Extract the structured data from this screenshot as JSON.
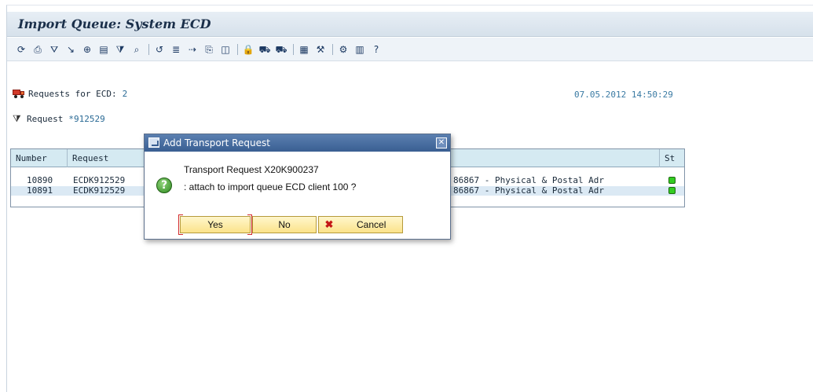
{
  "window": {
    "title": "Import Queue: System ECD"
  },
  "toolbar": {
    "icons": [
      {
        "name": "refresh-icon",
        "glyph": "⟳"
      },
      {
        "name": "print-icon",
        "glyph": "⎙"
      },
      {
        "name": "filter-icon",
        "glyph": "⛛"
      },
      {
        "name": "select-icon",
        "glyph": "↘"
      },
      {
        "name": "zoom-icon",
        "glyph": "⊕"
      },
      {
        "name": "display-icon",
        "glyph": "▤"
      },
      {
        "name": "set-filter-icon",
        "glyph": "⧩"
      },
      {
        "name": "find-icon",
        "glyph": "⌕"
      },
      {
        "name": "history-icon",
        "glyph": "↺"
      },
      {
        "name": "log-icon",
        "glyph": "≣"
      },
      {
        "name": "transport-icon",
        "glyph": "⇢"
      },
      {
        "name": "document-icon",
        "glyph": "⎘"
      },
      {
        "name": "details-icon",
        "glyph": "◫"
      },
      {
        "name": "lock-icon",
        "glyph": "🔒"
      },
      {
        "name": "import-truck-icon",
        "glyph": "⛟"
      },
      {
        "name": "import-all-icon",
        "glyph": "⛟"
      },
      {
        "name": "layout-icon",
        "glyph": "▦"
      },
      {
        "name": "tools-icon",
        "glyph": "⚒"
      },
      {
        "name": "settings-icon",
        "glyph": "⚙"
      },
      {
        "name": "grid-icon",
        "glyph": "▥"
      },
      {
        "name": "help-icon",
        "glyph": "?"
      }
    ]
  },
  "info": {
    "requests_label": "Requests for ECD:",
    "requests_count": "2",
    "timestamp": "07.05.2012 14:50:29",
    "filter_label": "Request",
    "filter_value": "*912529"
  },
  "grid": {
    "columns": {
      "number": "Number",
      "request": "Request",
      "status": "St"
    },
    "rows": [
      {
        "number": "10890",
        "request": "ECDK912529",
        "description": "86867 - Physical & Postal Adr"
      },
      {
        "number": "10891",
        "request": "ECDK912529",
        "description": "86867 - Physical & Postal Adr"
      }
    ]
  },
  "dialog": {
    "title": "Add Transport Request",
    "line1": "Transport Request X20K900237",
    "line2": ": attach to import queue ECD client 100 ?",
    "yes_label": "Yes",
    "no_label": "No",
    "cancel_label": "Cancel"
  }
}
